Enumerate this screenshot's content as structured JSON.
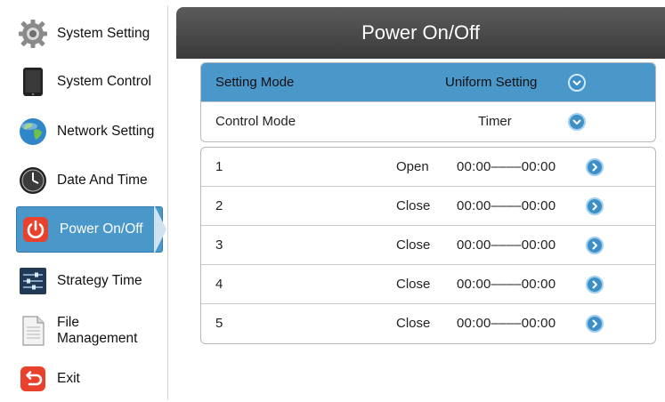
{
  "sidebar": {
    "items": [
      {
        "label": "System Setting",
        "icon": "gear-icon"
      },
      {
        "label": "System Control",
        "icon": "tablet-icon"
      },
      {
        "label": "Network Setting",
        "icon": "globe-icon"
      },
      {
        "label": "Date And Time",
        "icon": "clock-icon"
      },
      {
        "label": "Power On/Off",
        "icon": "power-icon",
        "active": true
      },
      {
        "label": "Strategy Time",
        "icon": "sliders-icon"
      },
      {
        "label": "File Management",
        "label_line1": "File",
        "label_line2": "Management",
        "icon": "document-icon"
      },
      {
        "label": "Exit",
        "icon": "exit-icon"
      }
    ]
  },
  "header": {
    "title": "Power On/Off"
  },
  "settings": {
    "setting_mode": {
      "label": "Setting Mode",
      "value": "Uniform Setting"
    },
    "control_mode": {
      "label": "Control Mode",
      "value": "Timer"
    }
  },
  "timers": [
    {
      "num": "1",
      "state": "Open",
      "range": "00:00––––00:00"
    },
    {
      "num": "2",
      "state": "Close",
      "range": "00:00––––00:00"
    },
    {
      "num": "3",
      "state": "Close",
      "range": "00:00––––00:00"
    },
    {
      "num": "4",
      "state": "Close",
      "range": "00:00––––00:00"
    },
    {
      "num": "5",
      "state": "Close",
      "range": "00:00––––00:00"
    }
  ],
  "colors": {
    "accent": "#4a97c9",
    "header": "#4a4a4a",
    "icon_blue": "#3d8fc6",
    "power_red": "#e8412c"
  }
}
